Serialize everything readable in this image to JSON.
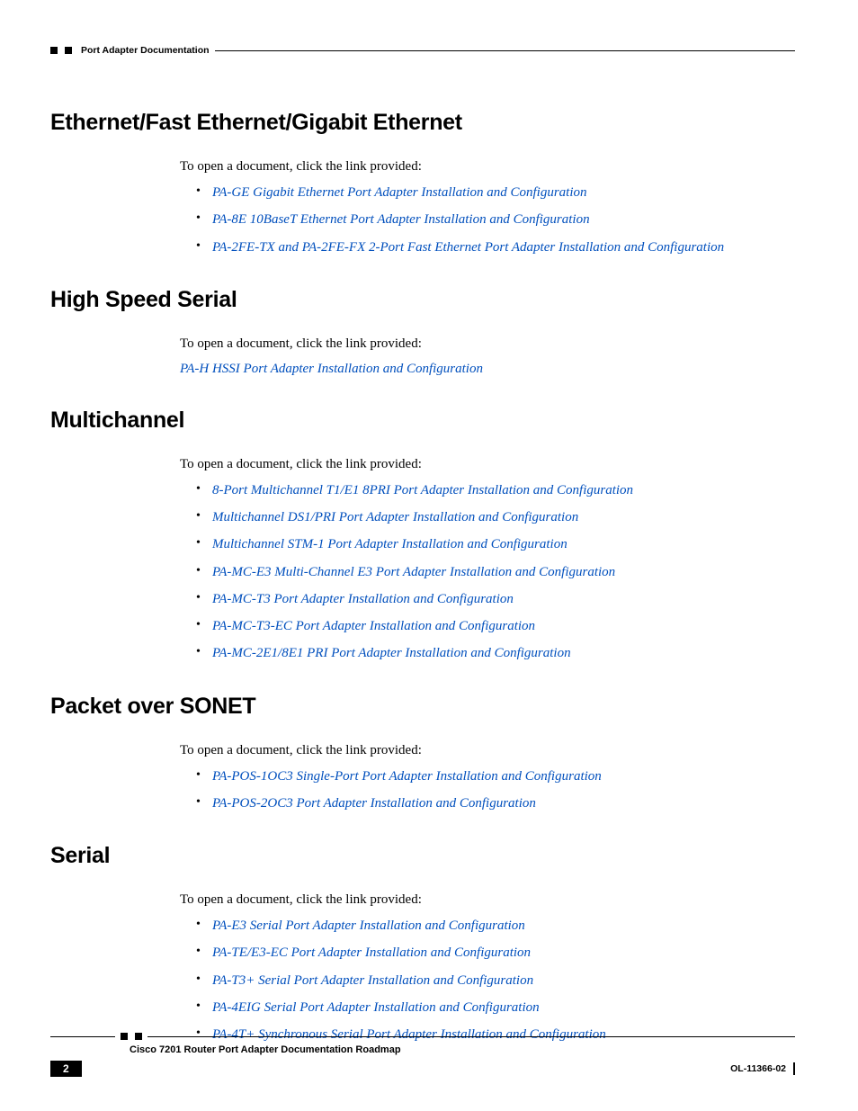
{
  "header": {
    "breadcrumb": "Port Adapter Documentation"
  },
  "sections": [
    {
      "heading": "Ethernet/Fast Ethernet/Gigabit Ethernet",
      "intro": "To open a document, click the link provided:",
      "links": [
        "PA-GE Gigabit Ethernet Port Adapter Installation and Configuration",
        "PA-8E 10BaseT Ethernet Port Adapter Installation and Configuration",
        "PA-2FE-TX and PA-2FE-FX 2-Port Fast Ethernet Port Adapter Installation and Configuration"
      ]
    },
    {
      "heading": "High Speed Serial",
      "intro": "To open a document, click the link provided:",
      "single_link": "PA-H HSSI Port Adapter Installation and Configuration"
    },
    {
      "heading": "Multichannel",
      "intro": "To open a document, click the link provided:",
      "links": [
        "8-Port Multichannel T1/E1 8PRI Port Adapter Installation and Configuration",
        "Multichannel DS1/PRI Port Adapter Installation and Configuration",
        "Multichannel STM-1 Port Adapter Installation and Configuration",
        "PA-MC-E3 Multi-Channel E3 Port Adapter Installation and Configuration",
        "PA-MC-T3 Port Adapter Installation and Configuration",
        "PA-MC-T3-EC Port Adapter Installation and Configuration",
        "PA-MC-2E1/8E1 PRI Port Adapter Installation and Configuration"
      ]
    },
    {
      "heading": "Packet over SONET",
      "intro": "To open a document, click the link provided:",
      "links": [
        "PA-POS-1OC3 Single-Port Port Adapter Installation and Configuration",
        "PA-POS-2OC3 Port Adapter Installation and Configuration"
      ]
    },
    {
      "heading": "Serial",
      "intro": "To open a document, click the link provided:",
      "links": [
        "PA-E3 Serial Port Adapter Installation and Configuration",
        "PA-TE/E3-EC Port Adapter Installation and Configuration",
        "PA-T3+ Serial Port Adapter Installation and Configuration",
        "PA-4EIG Serial Port Adapter Installation and Configuration",
        "PA-4T+ Synchronous Serial Port Adapter Installation and Configuration"
      ]
    }
  ],
  "footer": {
    "title": "Cisco 7201 Router Port Adapter Documentation Roadmap",
    "page": "2",
    "docid": "OL-11366-02"
  }
}
